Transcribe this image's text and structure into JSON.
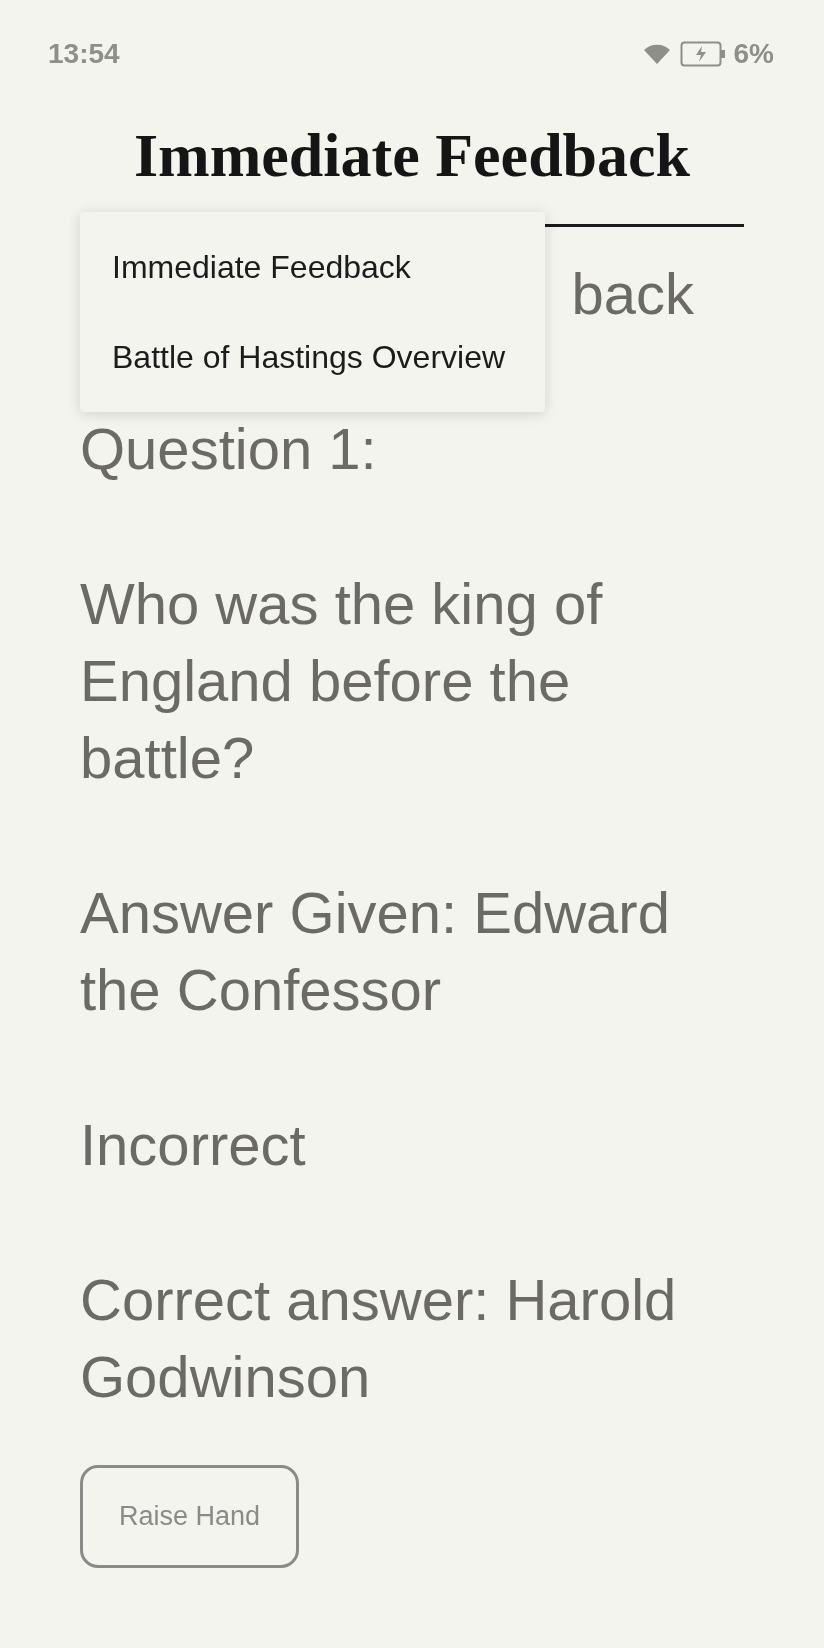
{
  "status_bar": {
    "time": "13:54",
    "battery": "6%"
  },
  "header": {
    "title": "Immediate Feedback"
  },
  "dropdown": {
    "items": [
      {
        "label": "Immediate Feedback"
      },
      {
        "label": "Battle of Hastings Overview"
      }
    ]
  },
  "content": {
    "heading_fragment": "back",
    "paragraphs": [
      "Question 1:",
      "Who was the king of England before the battle?",
      "Answer Given: Edward the Confessor",
      "Incorrect",
      "Correct answer: Harold Godwinson"
    ]
  },
  "button": {
    "label": "Raise Hand"
  }
}
